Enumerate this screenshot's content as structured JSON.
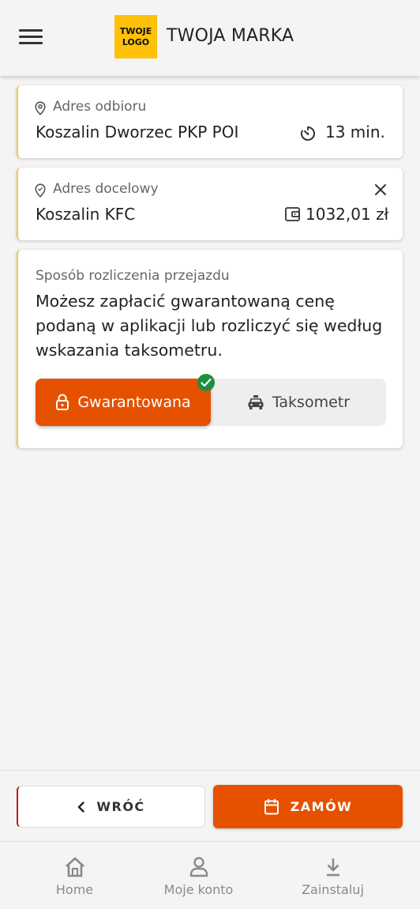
{
  "header": {
    "logo_line1": "TWOJE",
    "logo_line2": "LOGO",
    "brand": "TWOJA MARKA",
    "logo_color": "#ffc107"
  },
  "pickup": {
    "label": "Adres odbioru",
    "address": "Koszalin Dworzec PKP POI",
    "eta": "13 min.",
    "icon": "location-pin-icon"
  },
  "destination": {
    "label": "Adres docelowy",
    "address": "Koszalin KFC",
    "price": "1032,01 zł",
    "icon": "location-pin-icon"
  },
  "payment": {
    "label": "Sposób rozliczenia przejazdu",
    "description": "Możesz zapłacić gwarantowaną cenę podaną w aplikacji lub rozliczyć się według wskazania taksometru.",
    "options": [
      {
        "label": "Gwarantowana",
        "icon": "lock-icon",
        "selected": true
      },
      {
        "label": "Taksometr",
        "icon": "taxi-icon",
        "selected": false
      }
    ]
  },
  "actions": {
    "back_label": "WRÓĆ",
    "order_label": "ZAMÓW"
  },
  "nav": [
    {
      "label": "Home",
      "icon": "home-icon"
    },
    {
      "label": "Moje konto",
      "icon": "user-icon"
    },
    {
      "label": "Zainstaluj",
      "icon": "download-icon"
    }
  ],
  "colors": {
    "accent": "#e65100",
    "card_border": "#f2c94c",
    "success": "#1e8e3e"
  }
}
